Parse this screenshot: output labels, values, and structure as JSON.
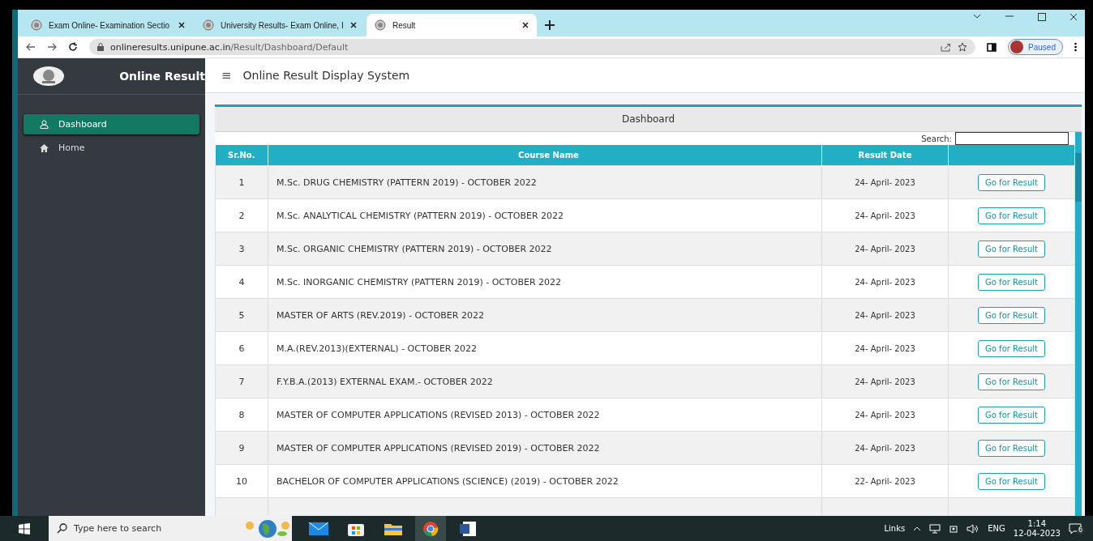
{
  "browser": {
    "tabs": [
      {
        "title": "Exam Online- Examination Sectio",
        "selected": false
      },
      {
        "title": "University Results- Exam Online, I",
        "selected": false
      },
      {
        "title": "Result",
        "selected": true
      }
    ],
    "url_host": "onlineresults.unipune.ac.in",
    "url_path": "/Result/Dashboard/Default",
    "profile": "Paused"
  },
  "sidebar": {
    "title": "Online Result",
    "items": [
      {
        "label": "Dashboard",
        "selected": true
      },
      {
        "label": "Home",
        "selected": false
      }
    ]
  },
  "header": {
    "menu": "≡",
    "title": "Online Result Display System"
  },
  "card": {
    "title": "Dashboard",
    "search_label": "Search:"
  },
  "table": {
    "columns": [
      "Sr.No.",
      "Course Name",
      "Result Date"
    ],
    "rows": [
      {
        "sr": "1",
        "course": "M.Sc. DRUG CHEMISTRY (PATTERN 2019) - OCTOBER 2022",
        "date": "24- April- 2023",
        "action": "Go for Result"
      },
      {
        "sr": "2",
        "course": "M.Sc. ANALYTICAL CHEMISTRY (PATTERN 2019) - OCTOBER 2022",
        "date": "24- April- 2023",
        "action": "Go for Result"
      },
      {
        "sr": "3",
        "course": "M.Sc. ORGANIC CHEMISTRY (PATTERN 2019) - OCTOBER 2022",
        "date": "24- April- 2023",
        "action": "Go for Result"
      },
      {
        "sr": "4",
        "course": "M.Sc. INORGANIC CHEMISTRY (PATTERN 2019) - OCTOBER 2022",
        "date": "24- April- 2023",
        "action": "Go for Result"
      },
      {
        "sr": "5",
        "course": "MASTER OF ARTS (REV.2019) - OCTOBER 2022",
        "date": "24- April- 2023",
        "action": "Go for Result"
      },
      {
        "sr": "6",
        "course": "M.A.(REV.2013)(EXTERNAL) - OCTOBER 2022",
        "date": "24- April- 2023",
        "action": "Go for Result"
      },
      {
        "sr": "7",
        "course": "F.Y.B.A.(2013) EXTERNAL EXAM.- OCTOBER 2022",
        "date": "24- April- 2023",
        "action": "Go for Result"
      },
      {
        "sr": "8",
        "course": "MASTER OF COMPUTER APPLICATIONS (REVISED 2013) - OCTOBER 2022",
        "date": "24- April- 2023",
        "action": "Go for Result"
      },
      {
        "sr": "9",
        "course": "MASTER OF COMPUTER APPLICATIONS (REVISED 2019) - OCTOBER 2022",
        "date": "24- April- 2023",
        "action": "Go for Result"
      },
      {
        "sr": "10",
        "course": "BACHELOR OF COMPUTER APPLICATIONS (SCIENCE) (2019) - OCTOBER 2022",
        "date": "22- April- 2023",
        "action": "Go for Result"
      }
    ]
  },
  "taskbar": {
    "search_placeholder": "Type here to search",
    "links": "Links",
    "language": "ENG",
    "time": "1:14",
    "date": "12-04-2023",
    "notifications": "6"
  }
}
